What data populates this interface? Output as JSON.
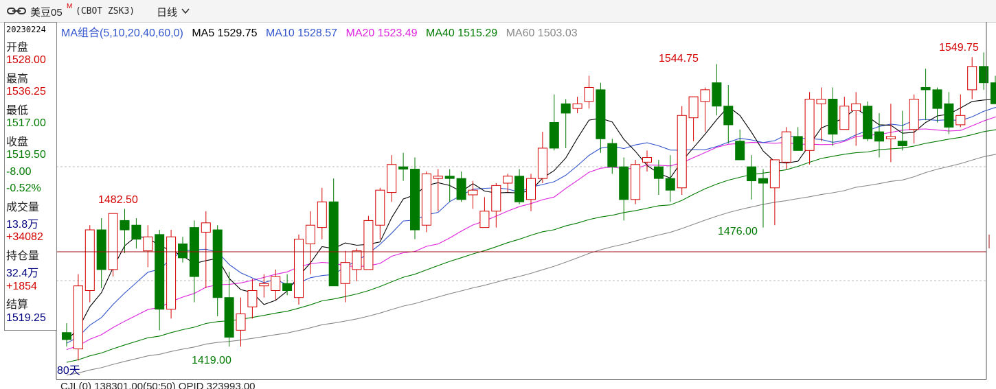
{
  "toolbar": {
    "symbol_name": "美豆05",
    "symbol_badge": "M",
    "symbol_code": "(CBOT ZSK3)",
    "period_label": "日线"
  },
  "info_panel": {
    "date": "20230224",
    "open_label": "开盘",
    "open_value": "1528.00",
    "high_label": "最高",
    "high_value": "1536.25",
    "low_label": "最低",
    "low_value": "1517.00",
    "close_label": "收盘",
    "close_value": "1519.50",
    "change": "-8.00",
    "change_pct": "-0.52%",
    "volume_label": "成交量",
    "volume_value": "13.8万",
    "volume_change": "+34082",
    "oi_label": "持仓量",
    "oi_value": "32.4万",
    "oi_change": "+1854",
    "settle_label": "结算",
    "settle_value": "1519.25"
  },
  "legend": {
    "group": "MA组合(5,10,20,40,60,0)",
    "ma5": "MA5 1529.75",
    "ma10": "MA10 1528.57",
    "ma20": "MA20 1523.49",
    "ma40": "MA40 1515.29",
    "ma60": "MA60 1503.03"
  },
  "chart_annotations": {
    "period_count": "80天",
    "high1": "1482.50",
    "low1": "1419.00",
    "high2": "1544.75",
    "low2": "1476.00",
    "high3": "1549.75"
  },
  "bottom_panel": {
    "text": "CJL(0)    138301.00(50:50)  OPID 323993.00"
  },
  "colors": {
    "up": "#d40000",
    "down": "#007a00",
    "ma5": "#000000",
    "ma10": "#3355cc",
    "ma20": "#dd22dd",
    "ma40": "#007a00",
    "ma60": "#888888"
  },
  "chart_data": {
    "type": "candlestick",
    "y_range": [
      1412,
      1556
    ],
    "candles": [
      [
        1430,
        1434,
        1424,
        1427
      ],
      [
        1423,
        1455,
        1418,
        1450
      ],
      [
        1448,
        1476,
        1443,
        1474
      ],
      [
        1474,
        1479,
        1449,
        1457
      ],
      [
        1457,
        1481,
        1454,
        1481
      ],
      [
        1478,
        1483,
        1464,
        1474
      ],
      [
        1476,
        1479,
        1466,
        1470
      ],
      [
        1465,
        1476,
        1458,
        1471
      ],
      [
        1472,
        1474,
        1431,
        1440
      ],
      [
        1440,
        1474,
        1436,
        1471
      ],
      [
        1468,
        1471,
        1460,
        1462
      ],
      [
        1475,
        1478,
        1443,
        1454
      ],
      [
        1473,
        1482,
        1449,
        1477
      ],
      [
        1474,
        1476,
        1437,
        1445
      ],
      [
        1445,
        1456,
        1424,
        1428
      ],
      [
        1431,
        1445,
        1424,
        1438
      ],
      [
        1441,
        1453,
        1436,
        1448
      ],
      [
        1450,
        1455,
        1445,
        1451
      ],
      [
        1448,
        1457,
        1444,
        1454
      ],
      [
        1451,
        1455,
        1446,
        1448
      ],
      [
        1445,
        1472,
        1442,
        1470
      ],
      [
        1468,
        1482,
        1455,
        1476
      ],
      [
        1475,
        1492,
        1470,
        1486
      ],
      [
        1486,
        1496,
        1465,
        1450
      ],
      [
        1451,
        1465,
        1443,
        1460
      ],
      [
        1457,
        1466,
        1452,
        1465
      ],
      [
        1457,
        1480,
        1458,
        1478
      ],
      [
        1476,
        1492,
        1470,
        1491
      ],
      [
        1490,
        1506,
        1486,
        1502
      ],
      [
        1501,
        1507,
        1495,
        1500
      ],
      [
        1500,
        1505,
        1470,
        1474
      ],
      [
        1476,
        1499,
        1473,
        1498
      ],
      [
        1496,
        1500,
        1482,
        1497
      ],
      [
        1497,
        1500,
        1486,
        1496
      ],
      [
        1496,
        1499,
        1486,
        1487
      ],
      [
        1489,
        1495,
        1483,
        1491
      ],
      [
        1475,
        1488,
        1475,
        1482
      ],
      [
        1482,
        1494,
        1475,
        1493
      ],
      [
        1494,
        1498,
        1490,
        1497
      ],
      [
        1497,
        1500,
        1485,
        1486
      ],
      [
        1487,
        1498,
        1482,
        1496
      ],
      [
        1496,
        1516,
        1494,
        1509
      ],
      [
        1520,
        1532,
        1508,
        1509
      ],
      [
        1528,
        1530,
        1509,
        1524
      ],
      [
        1526,
        1531,
        1524,
        1528
      ],
      [
        1529,
        1540,
        1526,
        1535
      ],
      [
        1534,
        1537,
        1507,
        1513
      ],
      [
        1511,
        1513,
        1498,
        1501
      ],
      [
        1501,
        1505,
        1478,
        1487
      ],
      [
        1487,
        1504,
        1485,
        1502
      ],
      [
        1503,
        1508,
        1499,
        1505
      ],
      [
        1501,
        1504,
        1489,
        1496
      ],
      [
        1496,
        1506,
        1486,
        1491
      ],
      [
        1492,
        1527,
        1489,
        1523
      ],
      [
        1522,
        1528,
        1512,
        1531
      ],
      [
        1529,
        1535,
        1516,
        1534
      ],
      [
        1537,
        1545,
        1523,
        1527
      ],
      [
        1527,
        1536,
        1511,
        1519
      ],
      [
        1512,
        1517,
        1504,
        1504
      ],
      [
        1501,
        1506,
        1487,
        1495
      ],
      [
        1496,
        1500,
        1475,
        1494
      ],
      [
        1492,
        1504,
        1476,
        1504
      ],
      [
        1503,
        1518,
        1500,
        1516
      ],
      [
        1514,
        1518,
        1508,
        1508
      ],
      [
        1508,
        1533,
        1502,
        1530
      ],
      [
        1528,
        1535,
        1512,
        1530
      ],
      [
        1530,
        1535,
        1510,
        1515
      ],
      [
        1517,
        1531,
        1520,
        1527
      ],
      [
        1525,
        1533,
        1510,
        1528
      ],
      [
        1527,
        1529,
        1512,
        1513
      ],
      [
        1516,
        1524,
        1505,
        1512
      ],
      [
        1513,
        1528,
        1503,
        1514
      ],
      [
        1512,
        1525,
        1508,
        1510
      ],
      [
        1517,
        1532,
        1511,
        1530
      ],
      [
        1535,
        1543,
        1521,
        1534
      ],
      [
        1534,
        1535,
        1520,
        1526
      ],
      [
        1528,
        1533,
        1515,
        1518
      ],
      [
        1519,
        1532,
        1518,
        1523
      ],
      [
        1534,
        1548,
        1530,
        1544
      ],
      [
        1544,
        1550,
        1534,
        1537
      ],
      [
        1537,
        1540,
        1528,
        1528
      ],
      [
        1528,
        1536,
        1517,
        1519.5
      ]
    ]
  }
}
